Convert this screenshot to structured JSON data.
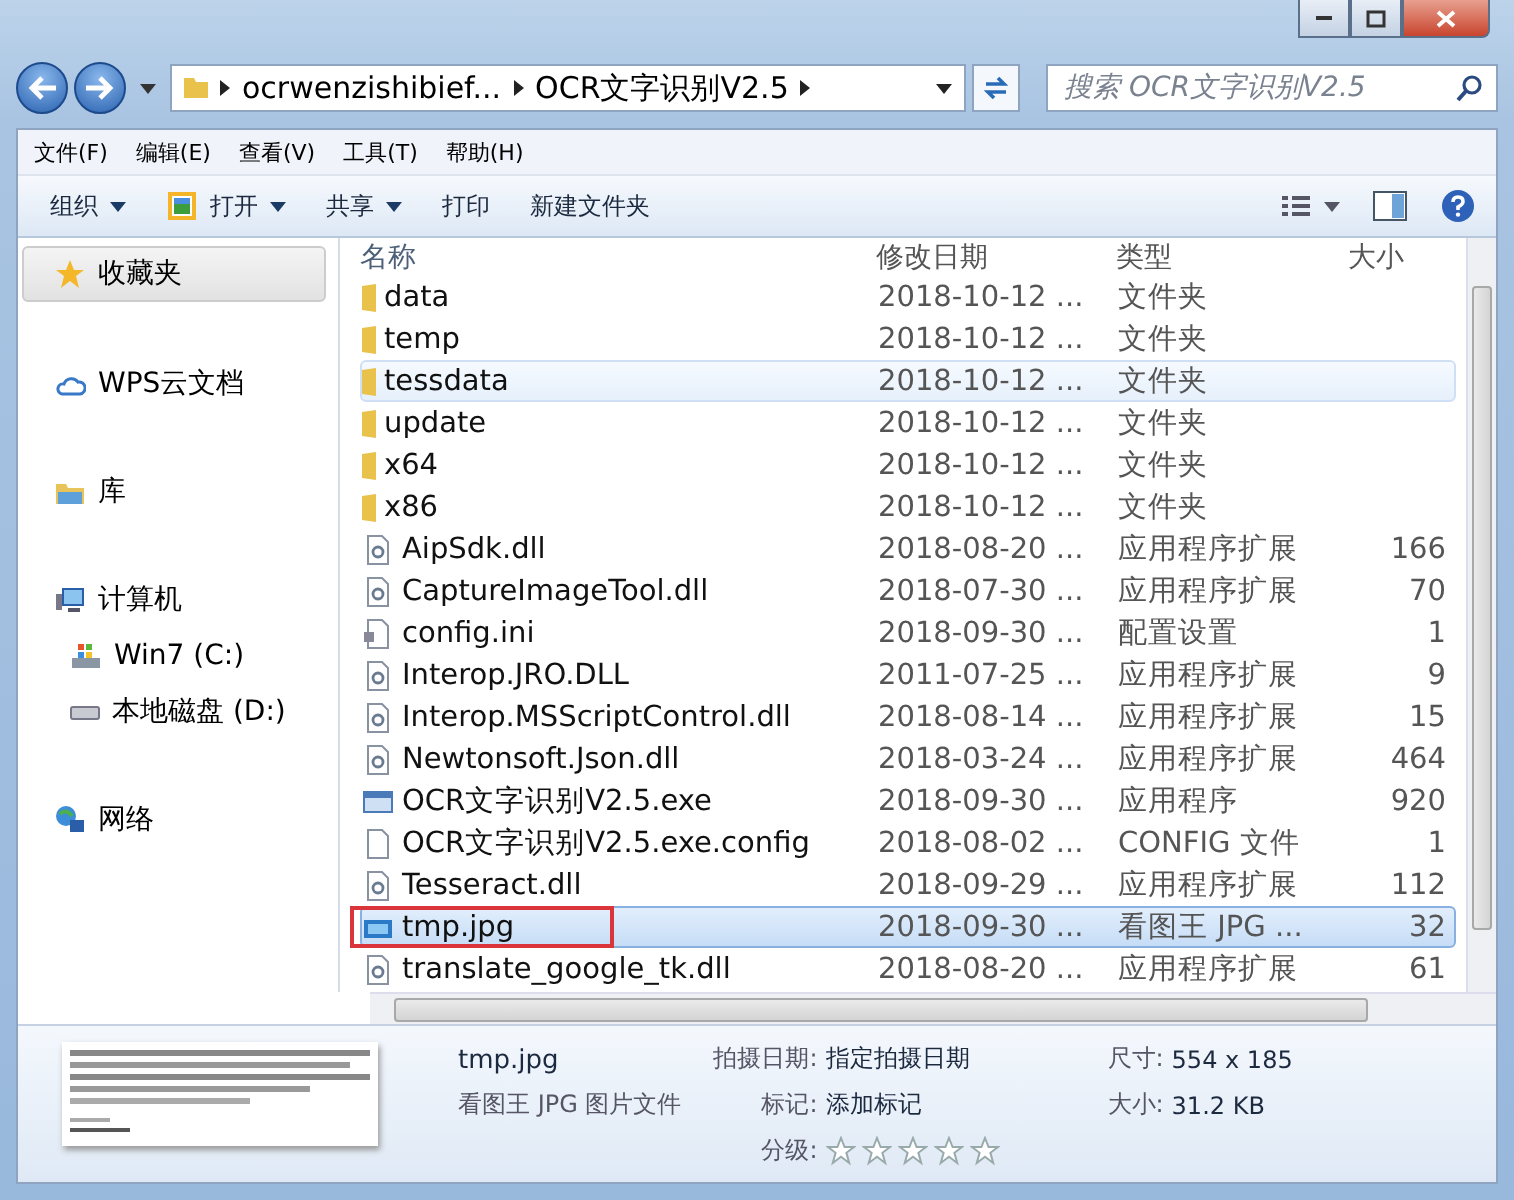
{
  "address": {
    "segments": [
      "ocrwenzishibief...",
      "OCR文字识别V2.5"
    ]
  },
  "search": {
    "placeholder": "搜索 OCR文字识别V2.5"
  },
  "menu": [
    "文件(F)",
    "编辑(E)",
    "查看(V)",
    "工具(T)",
    "帮助(H)"
  ],
  "toolbar": [
    {
      "label": "组织",
      "kind": "dropdown"
    },
    {
      "label": "打开",
      "kind": "open"
    },
    {
      "label": "共享",
      "kind": "dropdown"
    },
    {
      "label": "打印",
      "kind": "plain"
    },
    {
      "label": "新建文件夹",
      "kind": "plain"
    }
  ],
  "sidebar": {
    "items": [
      {
        "label": "收藏夹",
        "kind": "favorites",
        "selected": true
      },
      {
        "label": "WPS云文档",
        "kind": "cloud",
        "selected": false
      },
      {
        "label": "库",
        "kind": "library",
        "selected": false
      },
      {
        "label": "计算机",
        "kind": "computer",
        "selected": false,
        "children": [
          {
            "label": "Win7 (C:)",
            "kind": "system-drive",
            "selected": false
          },
          {
            "label": "本地磁盘 (D:)",
            "kind": "drive",
            "selected": false
          }
        ]
      },
      {
        "label": "网络",
        "kind": "network",
        "selected": false
      }
    ]
  },
  "table": {
    "columns": [
      "名称",
      "修改日期",
      "类型",
      "大小"
    ],
    "rows": [
      {
        "name": "data",
        "date": "2018-10-12 ...",
        "type": "文件夹",
        "kind": "folder",
        "selected": false,
        "hovered": false,
        "highlighted": false
      },
      {
        "name": "temp",
        "date": "2018-10-12 ...",
        "type": "文件夹",
        "kind": "folder",
        "selected": false,
        "hovered": false,
        "highlighted": false
      },
      {
        "name": "tessdata",
        "date": "2018-10-12 ...",
        "type": "文件夹",
        "kind": "folder",
        "selected": false,
        "hovered": true,
        "highlighted": false
      },
      {
        "name": "update",
        "date": "2018-10-12 ...",
        "type": "文件夹",
        "kind": "folder",
        "selected": false,
        "hovered": false,
        "highlighted": false
      },
      {
        "name": "x64",
        "date": "2018-10-12 ...",
        "type": "文件夹",
        "kind": "folder",
        "selected": false,
        "hovered": false,
        "highlighted": false
      },
      {
        "name": "x86",
        "date": "2018-10-12 ...",
        "type": "文件夹",
        "kind": "folder",
        "selected": false,
        "hovered": false,
        "highlighted": false
      },
      {
        "name": "AipSdk.dll",
        "date": "2018-08-20 ...",
        "type": "应用程序扩展",
        "size": "166",
        "kind": "dll",
        "selected": false,
        "hovered": false,
        "highlighted": false
      },
      {
        "name": "CaptureImageTool.dll",
        "date": "2018-07-30 ...",
        "type": "应用程序扩展",
        "size": "70",
        "kind": "dll",
        "selected": false,
        "hovered": false,
        "highlighted": false
      },
      {
        "name": "config.ini",
        "date": "2018-09-30 ...",
        "type": "配置设置",
        "size": "1",
        "kind": "ini",
        "selected": false,
        "hovered": false,
        "highlighted": false
      },
      {
        "name": "Interop.JRO.DLL",
        "date": "2011-07-25 ...",
        "type": "应用程序扩展",
        "size": "9",
        "kind": "dll",
        "selected": false,
        "hovered": false,
        "highlighted": false
      },
      {
        "name": "Interop.MSScriptControl.dll",
        "date": "2018-08-14 ...",
        "type": "应用程序扩展",
        "size": "15",
        "kind": "dll",
        "selected": false,
        "hovered": false,
        "highlighted": false
      },
      {
        "name": "Newtonsoft.Json.dll",
        "date": "2018-03-24 ...",
        "type": "应用程序扩展",
        "size": "464",
        "kind": "dll",
        "selected": false,
        "hovered": false,
        "highlighted": false
      },
      {
        "name": "OCR文字识别V2.5.exe",
        "date": "2018-09-30 ...",
        "type": "应用程序",
        "size": "920",
        "kind": "exe",
        "selected": false,
        "hovered": false,
        "highlighted": false
      },
      {
        "name": "OCR文字识别V2.5.exe.config",
        "date": "2018-08-02 ...",
        "type": "CONFIG 文件",
        "size": "1",
        "kind": "file",
        "selected": false,
        "hovered": false,
        "highlighted": false
      },
      {
        "name": "Tesseract.dll",
        "date": "2018-09-29 ...",
        "type": "应用程序扩展",
        "size": "112",
        "kind": "dll",
        "selected": false,
        "hovered": false,
        "highlighted": false
      },
      {
        "name": "tmp.jpg",
        "date": "2018-09-30 ...",
        "type": "看图王 JPG ...",
        "size": "32",
        "kind": "jpg",
        "selected": true,
        "hovered": false,
        "highlighted": true
      },
      {
        "name": "translate_google_tk.dll",
        "date": "2018-08-20 ...",
        "type": "应用程序扩展",
        "size": "61",
        "kind": "dll",
        "selected": false,
        "hovered": false,
        "highlighted": false
      }
    ]
  },
  "details": {
    "name": "tmp.jpg",
    "file_type": "看图王 JPG 图片文件",
    "fields": [
      {
        "label": "拍摄日期:",
        "value": "指定拍摄日期",
        "kind": "text"
      },
      {
        "label": "标记:",
        "value": "添加标记",
        "kind": "text"
      },
      {
        "label": "分级:",
        "stars": 0,
        "kind": "rating"
      }
    ],
    "fields_right": [
      {
        "label": "尺寸:",
        "value": "554 x 185"
      },
      {
        "label": "大小:",
        "value": "31.2 KB"
      }
    ]
  }
}
